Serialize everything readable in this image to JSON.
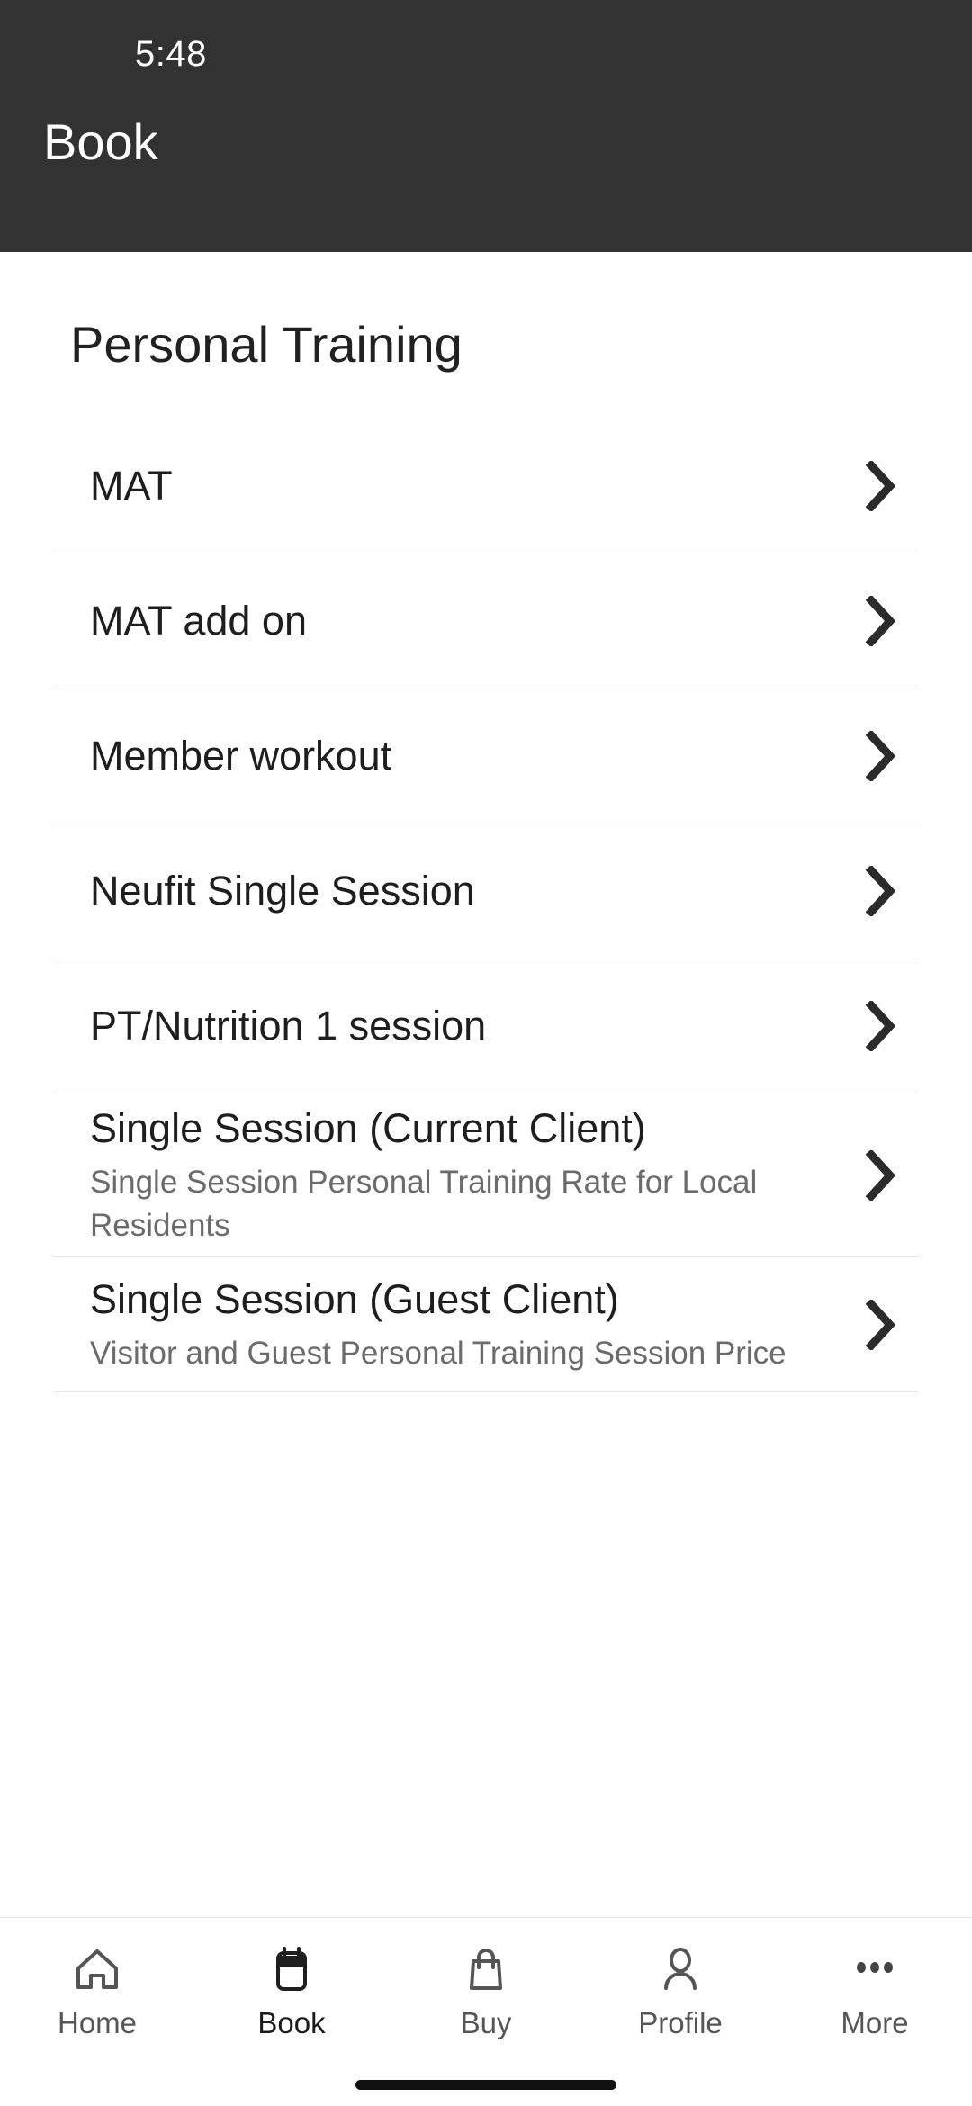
{
  "status_bar": {
    "time": "5:48"
  },
  "app_bar": {
    "title": "Book"
  },
  "page": {
    "title": "Personal Training"
  },
  "colors": {
    "header_bg": "#323232",
    "header_text": "#ffffff",
    "content_bg": "#ffffff",
    "title_text": "#212121",
    "item_title": "#1e1e1e",
    "item_subtitle": "#6b6b6b",
    "divider": "#e6e6e6",
    "nav_label": "#555555",
    "nav_label_active": "#1a1a1a"
  },
  "list": {
    "items": [
      {
        "title": "MAT",
        "subtitle": "",
        "chevron": "chevron-right-icon"
      },
      {
        "title": "MAT add on",
        "subtitle": "",
        "chevron": "chevron-right-icon"
      },
      {
        "title": "Member workout",
        "subtitle": "",
        "chevron": "chevron-right-icon"
      },
      {
        "title": "Neufit Single Session",
        "subtitle": "",
        "chevron": "chevron-right-icon"
      },
      {
        "title": "PT/Nutrition 1 session",
        "subtitle": "",
        "chevron": "chevron-right-icon"
      },
      {
        "title": "Single Session (Current Client)",
        "subtitle": "Single Session Personal Training Rate for Local Residents",
        "chevron": "chevron-right-icon"
      },
      {
        "title": "Single Session (Guest Client)",
        "subtitle": "Visitor and Guest Personal Training Session Price",
        "chevron": "chevron-right-icon"
      }
    ]
  },
  "bottom_nav": {
    "items": [
      {
        "label": "Home",
        "icon": "home-icon",
        "active": false
      },
      {
        "label": "Book",
        "icon": "calendar-icon",
        "active": true
      },
      {
        "label": "Buy",
        "icon": "shopping-bag-icon",
        "active": false
      },
      {
        "label": "Profile",
        "icon": "person-icon",
        "active": false
      },
      {
        "label": "More",
        "icon": "ellipsis-icon",
        "active": false
      }
    ]
  }
}
